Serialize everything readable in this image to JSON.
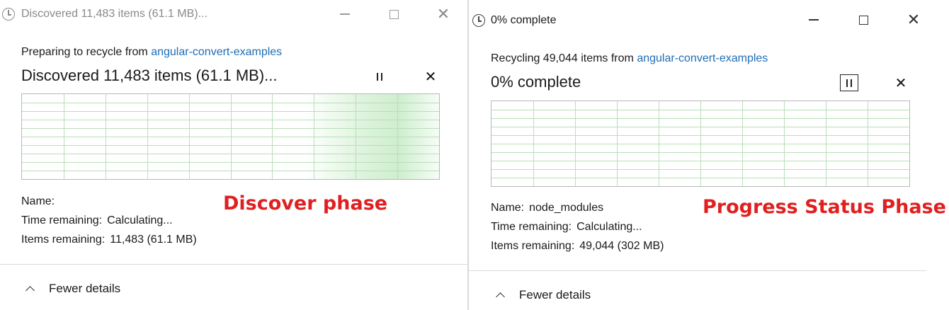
{
  "left": {
    "title": "Discovered 11,483 items (61.1 MB)...",
    "header_prefix": "Preparing to recycle from ",
    "header_link": "angular-convert-examples",
    "status": "Discovered 11,483 items (61.1 MB)...",
    "name_label": "Name:",
    "name_value": "",
    "time_label": "Time remaining:",
    "time_value": "Calculating...",
    "items_label": "Items remaining:",
    "items_value": "11,483 (61.1 MB)",
    "fewer_details": "Fewer details",
    "annotation": "Discover phase",
    "graph_grid_color": "#b9deb9",
    "graph_fill_color": "#c9ecc9"
  },
  "right": {
    "title": "0% complete",
    "header_prefix": "Recycling 49,044 items from ",
    "header_link": "angular-convert-examples",
    "status": "0% complete",
    "name_label": "Name:",
    "name_value": "node_modules",
    "time_label": "Time remaining:",
    "time_value": "Calculating...",
    "items_label": "Items remaining:",
    "items_value": "49,044 (302 MB)",
    "fewer_details": "Fewer details",
    "annotation": "Progress Status Phase",
    "graph_grid_color": "#b9deb9",
    "progress": 0
  },
  "icons": {
    "title_icon": "clock-icon",
    "pause": "pause-icon",
    "cancel": "close-icon",
    "collapse": "chevron-up-icon"
  },
  "colors": {
    "link": "#1e6db5",
    "annotation": "#e02020"
  }
}
